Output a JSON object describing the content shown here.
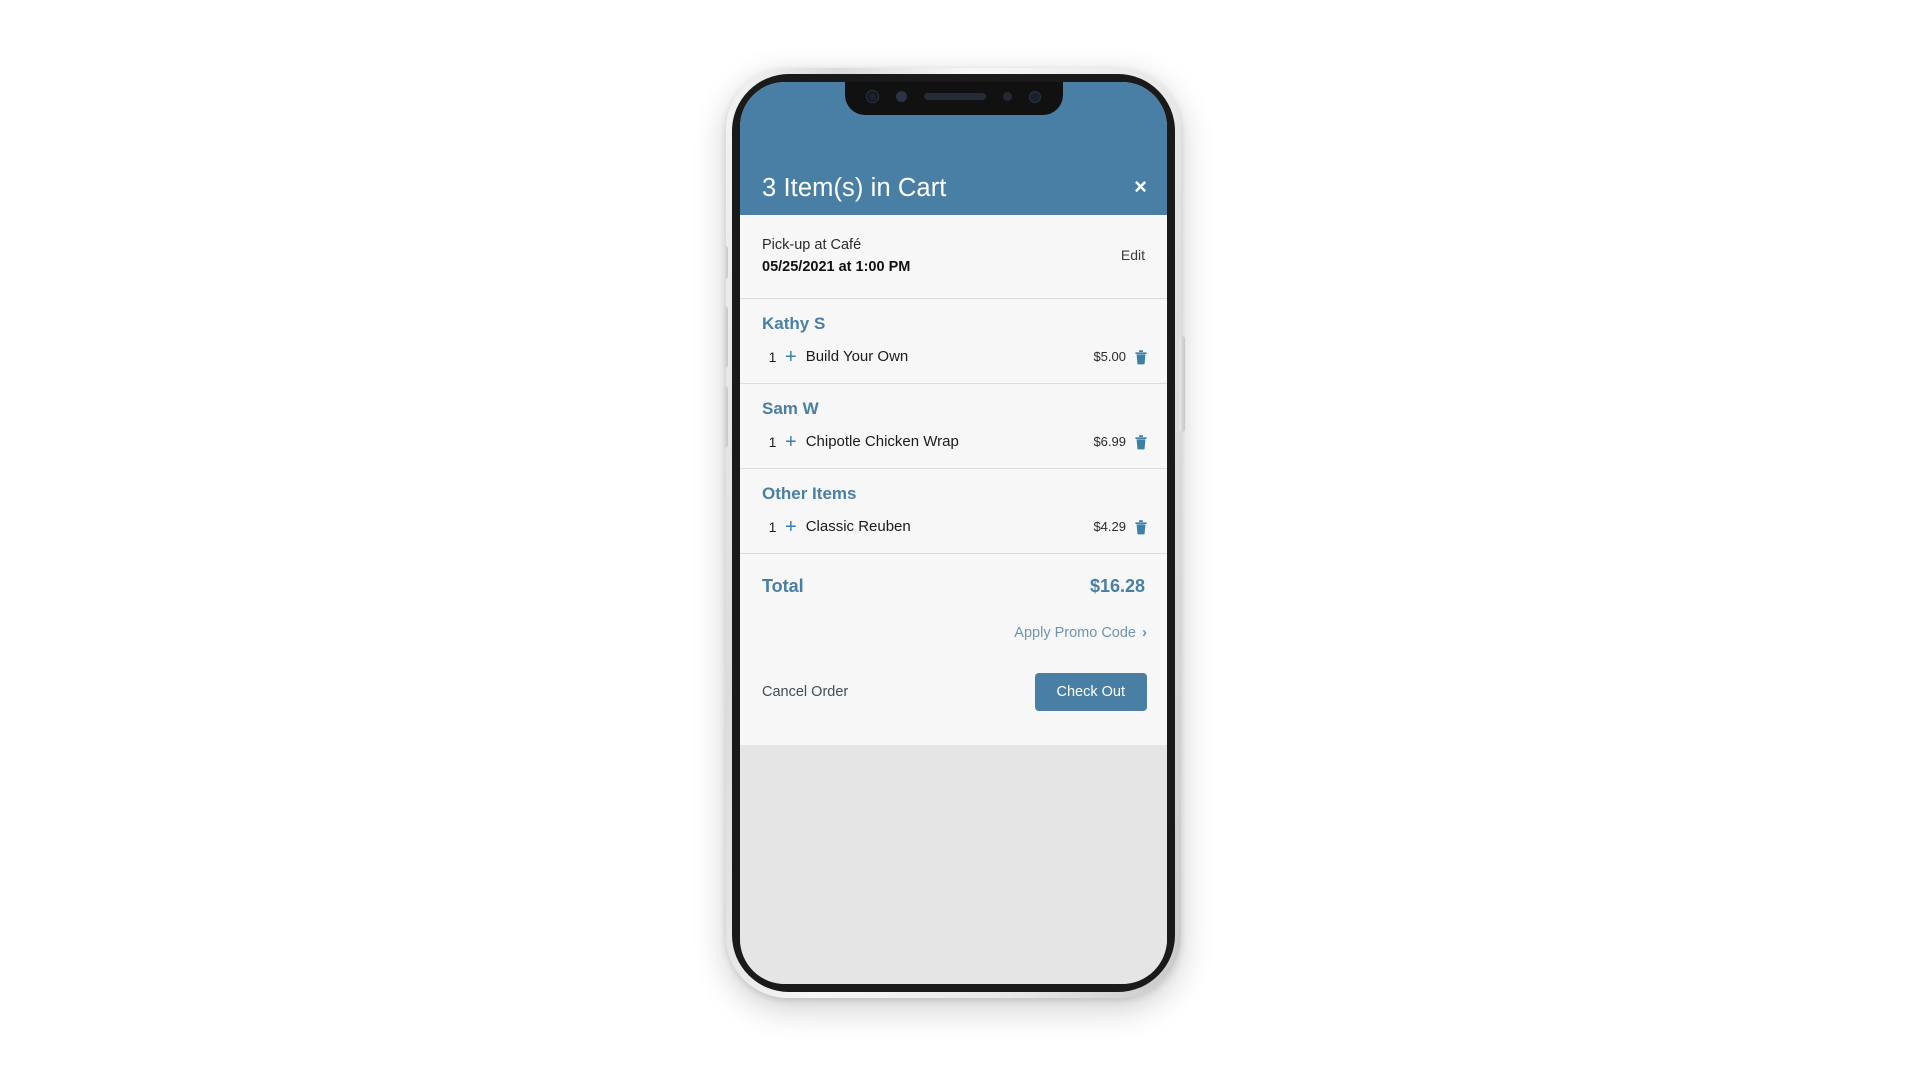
{
  "header": {
    "title": "3 Item(s) in Cart",
    "close_label": "×",
    "background_color": "#4a7fa5",
    "title_color": "#ffffff"
  },
  "pickup": {
    "label": "Pick-up at Café",
    "datetime": "05/25/2021 at 1:00 PM",
    "edit_label": "Edit"
  },
  "groups": [
    {
      "name": "Kathy S",
      "items": [
        {
          "qty": "1",
          "plus": "+",
          "name": "Build Your Own",
          "price": "$5.00"
        }
      ]
    },
    {
      "name": "Sam W",
      "items": [
        {
          "qty": "1",
          "plus": "+",
          "name": "Chipotle Chicken Wrap",
          "price": "$6.99"
        }
      ]
    },
    {
      "name": "Other Items",
      "items": [
        {
          "qty": "1",
          "plus": "+",
          "name": "Classic Reuben",
          "price": "$4.29"
        }
      ]
    }
  ],
  "total": {
    "label": "Total",
    "value": "$16.28"
  },
  "promo": {
    "label": "Apply Promo Code",
    "chevron": "›"
  },
  "actions": {
    "cancel_label": "Cancel Order",
    "checkout_label": "Check Out"
  },
  "colors": {
    "accent": "#4a7fa5",
    "link_muted": "#6f95b2",
    "sheet_bg": "#f7f7f7",
    "divider": "#d8dde1"
  }
}
